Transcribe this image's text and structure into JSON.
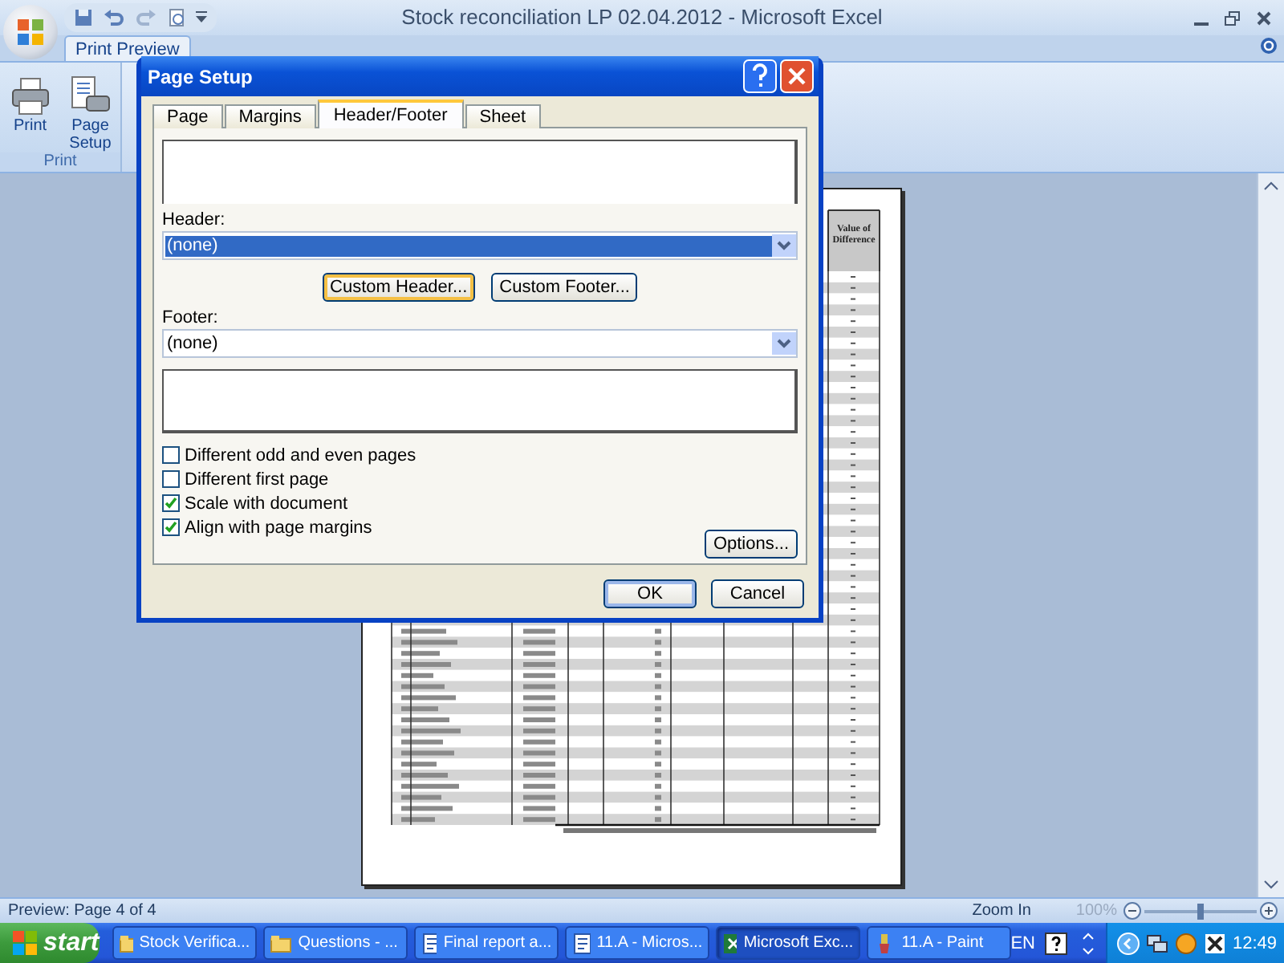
{
  "app": {
    "title": "Stock reconciliation LP 02.04.2012 - Microsoft Excel",
    "tabs": [
      {
        "label": "Print Preview",
        "selected": true
      }
    ],
    "ribbon": {
      "buttons": [
        {
          "label": "Print",
          "kind": "print"
        },
        {
          "label": "Page Setup",
          "kind": "setup"
        }
      ],
      "group": "Print"
    }
  },
  "preview": {
    "column_header": "Value of Difference"
  },
  "dialog": {
    "title": "Page Setup",
    "tabs": [
      {
        "label": "Page",
        "selected": false
      },
      {
        "label": "Margins",
        "selected": false
      },
      {
        "label": "Header/Footer",
        "selected": true
      },
      {
        "label": "Sheet",
        "selected": false
      }
    ],
    "fields": [
      {
        "label": "Header:",
        "value": "(none)",
        "focused": true
      },
      {
        "label": "Footer:",
        "value": "(none)",
        "focused": false
      }
    ],
    "custom_buttons": [
      {
        "label": "Custom Header...",
        "focused": true
      },
      {
        "label": "Custom Footer...",
        "focused": false
      }
    ],
    "options": [
      {
        "label": "Different odd and even pages",
        "checked": false
      },
      {
        "label": "Different first page",
        "checked": false
      },
      {
        "label": "Scale with document",
        "checked": true
      },
      {
        "label": "Align with page margins",
        "checked": true
      }
    ],
    "options_button": "Options...",
    "footer_buttons": [
      {
        "label": "OK",
        "default": true
      },
      {
        "label": "Cancel",
        "default": false
      }
    ]
  },
  "status_bar": {
    "text": "Preview: Page 4 of 4",
    "zoom_label": "Zoom In",
    "zoom": {
      "reading": "100%",
      "level": 0.5
    }
  },
  "taskbar": {
    "start": "start",
    "tasks": [
      {
        "label": "Stock Verifica...",
        "kind": "folder",
        "selected": false
      },
      {
        "label": "Questions - ...",
        "kind": "folder",
        "selected": false
      },
      {
        "label": "Final report a...",
        "kind": "document",
        "selected": false
      },
      {
        "label": "11.A - Micros...",
        "kind": "document",
        "selected": false
      },
      {
        "label": "Microsoft Exc...",
        "kind": "spreadsheet",
        "selected": true
      },
      {
        "label": "11.A - Paint",
        "kind": "paint",
        "selected": false
      }
    ],
    "language": "EN",
    "time": "12:49"
  }
}
